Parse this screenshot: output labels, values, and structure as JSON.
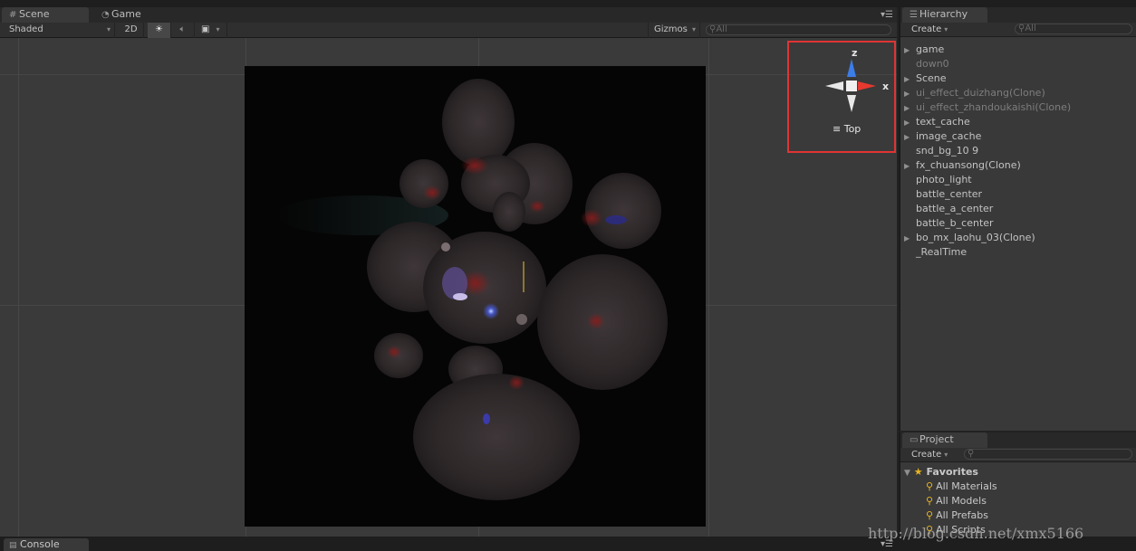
{
  "scene_panel": {
    "tabs": [
      {
        "label": "Scene",
        "icon": "grid-icon",
        "active": true
      },
      {
        "label": "Game",
        "icon": "pacman-icon",
        "active": false
      }
    ],
    "toolbar": {
      "shading_mode": "Shaded",
      "mode_2d": "2D",
      "gizmos_label": "Gizmos",
      "search_placeholder": "All"
    },
    "gizmo": {
      "axis_z": "z",
      "axis_x": "x",
      "view_label": "Top"
    }
  },
  "hierarchy": {
    "tab_label": "Hierarchy",
    "create_label": "Create",
    "search_placeholder": "All",
    "items": [
      {
        "label": "game",
        "expandable": true,
        "dim": false
      },
      {
        "label": "down0",
        "expandable": false,
        "dim": true
      },
      {
        "label": "Scene",
        "expandable": true,
        "dim": false
      },
      {
        "label": "ui_effect_duizhang(Clone)",
        "expandable": true,
        "dim": true
      },
      {
        "label": "ui_effect_zhandoukaishi(Clone)",
        "expandable": true,
        "dim": true
      },
      {
        "label": "text_cache",
        "expandable": true,
        "dim": false
      },
      {
        "label": "image_cache",
        "expandable": true,
        "dim": false
      },
      {
        "label": "snd_bg_10 9",
        "expandable": false,
        "dim": false
      },
      {
        "label": "fx_chuansong(Clone)",
        "expandable": true,
        "dim": false
      },
      {
        "label": "photo_light",
        "expandable": false,
        "dim": false
      },
      {
        "label": "battle_center",
        "expandable": false,
        "dim": false
      },
      {
        "label": "battle_a_center",
        "expandable": false,
        "dim": false
      },
      {
        "label": "battle_b_center",
        "expandable": false,
        "dim": false
      },
      {
        "label": "bo_mx_laohu_03(Clone)",
        "expandable": true,
        "dim": false
      },
      {
        "label": "_RealTime",
        "expandable": false,
        "dim": false
      }
    ]
  },
  "project": {
    "tab_label": "Project",
    "create_label": "Create",
    "favorites_label": "Favorites",
    "favorites": [
      "All Materials",
      "All Models",
      "All Prefabs",
      "All Scripts"
    ]
  },
  "console": {
    "tab_label": "Console"
  },
  "watermark": "http://blog.csdn.net/xmx5166",
  "colors": {
    "axis_z": "#3c7de8",
    "axis_x": "#e8392f",
    "highlight_box": "#e03434",
    "favorite_star": "#e6b422"
  }
}
